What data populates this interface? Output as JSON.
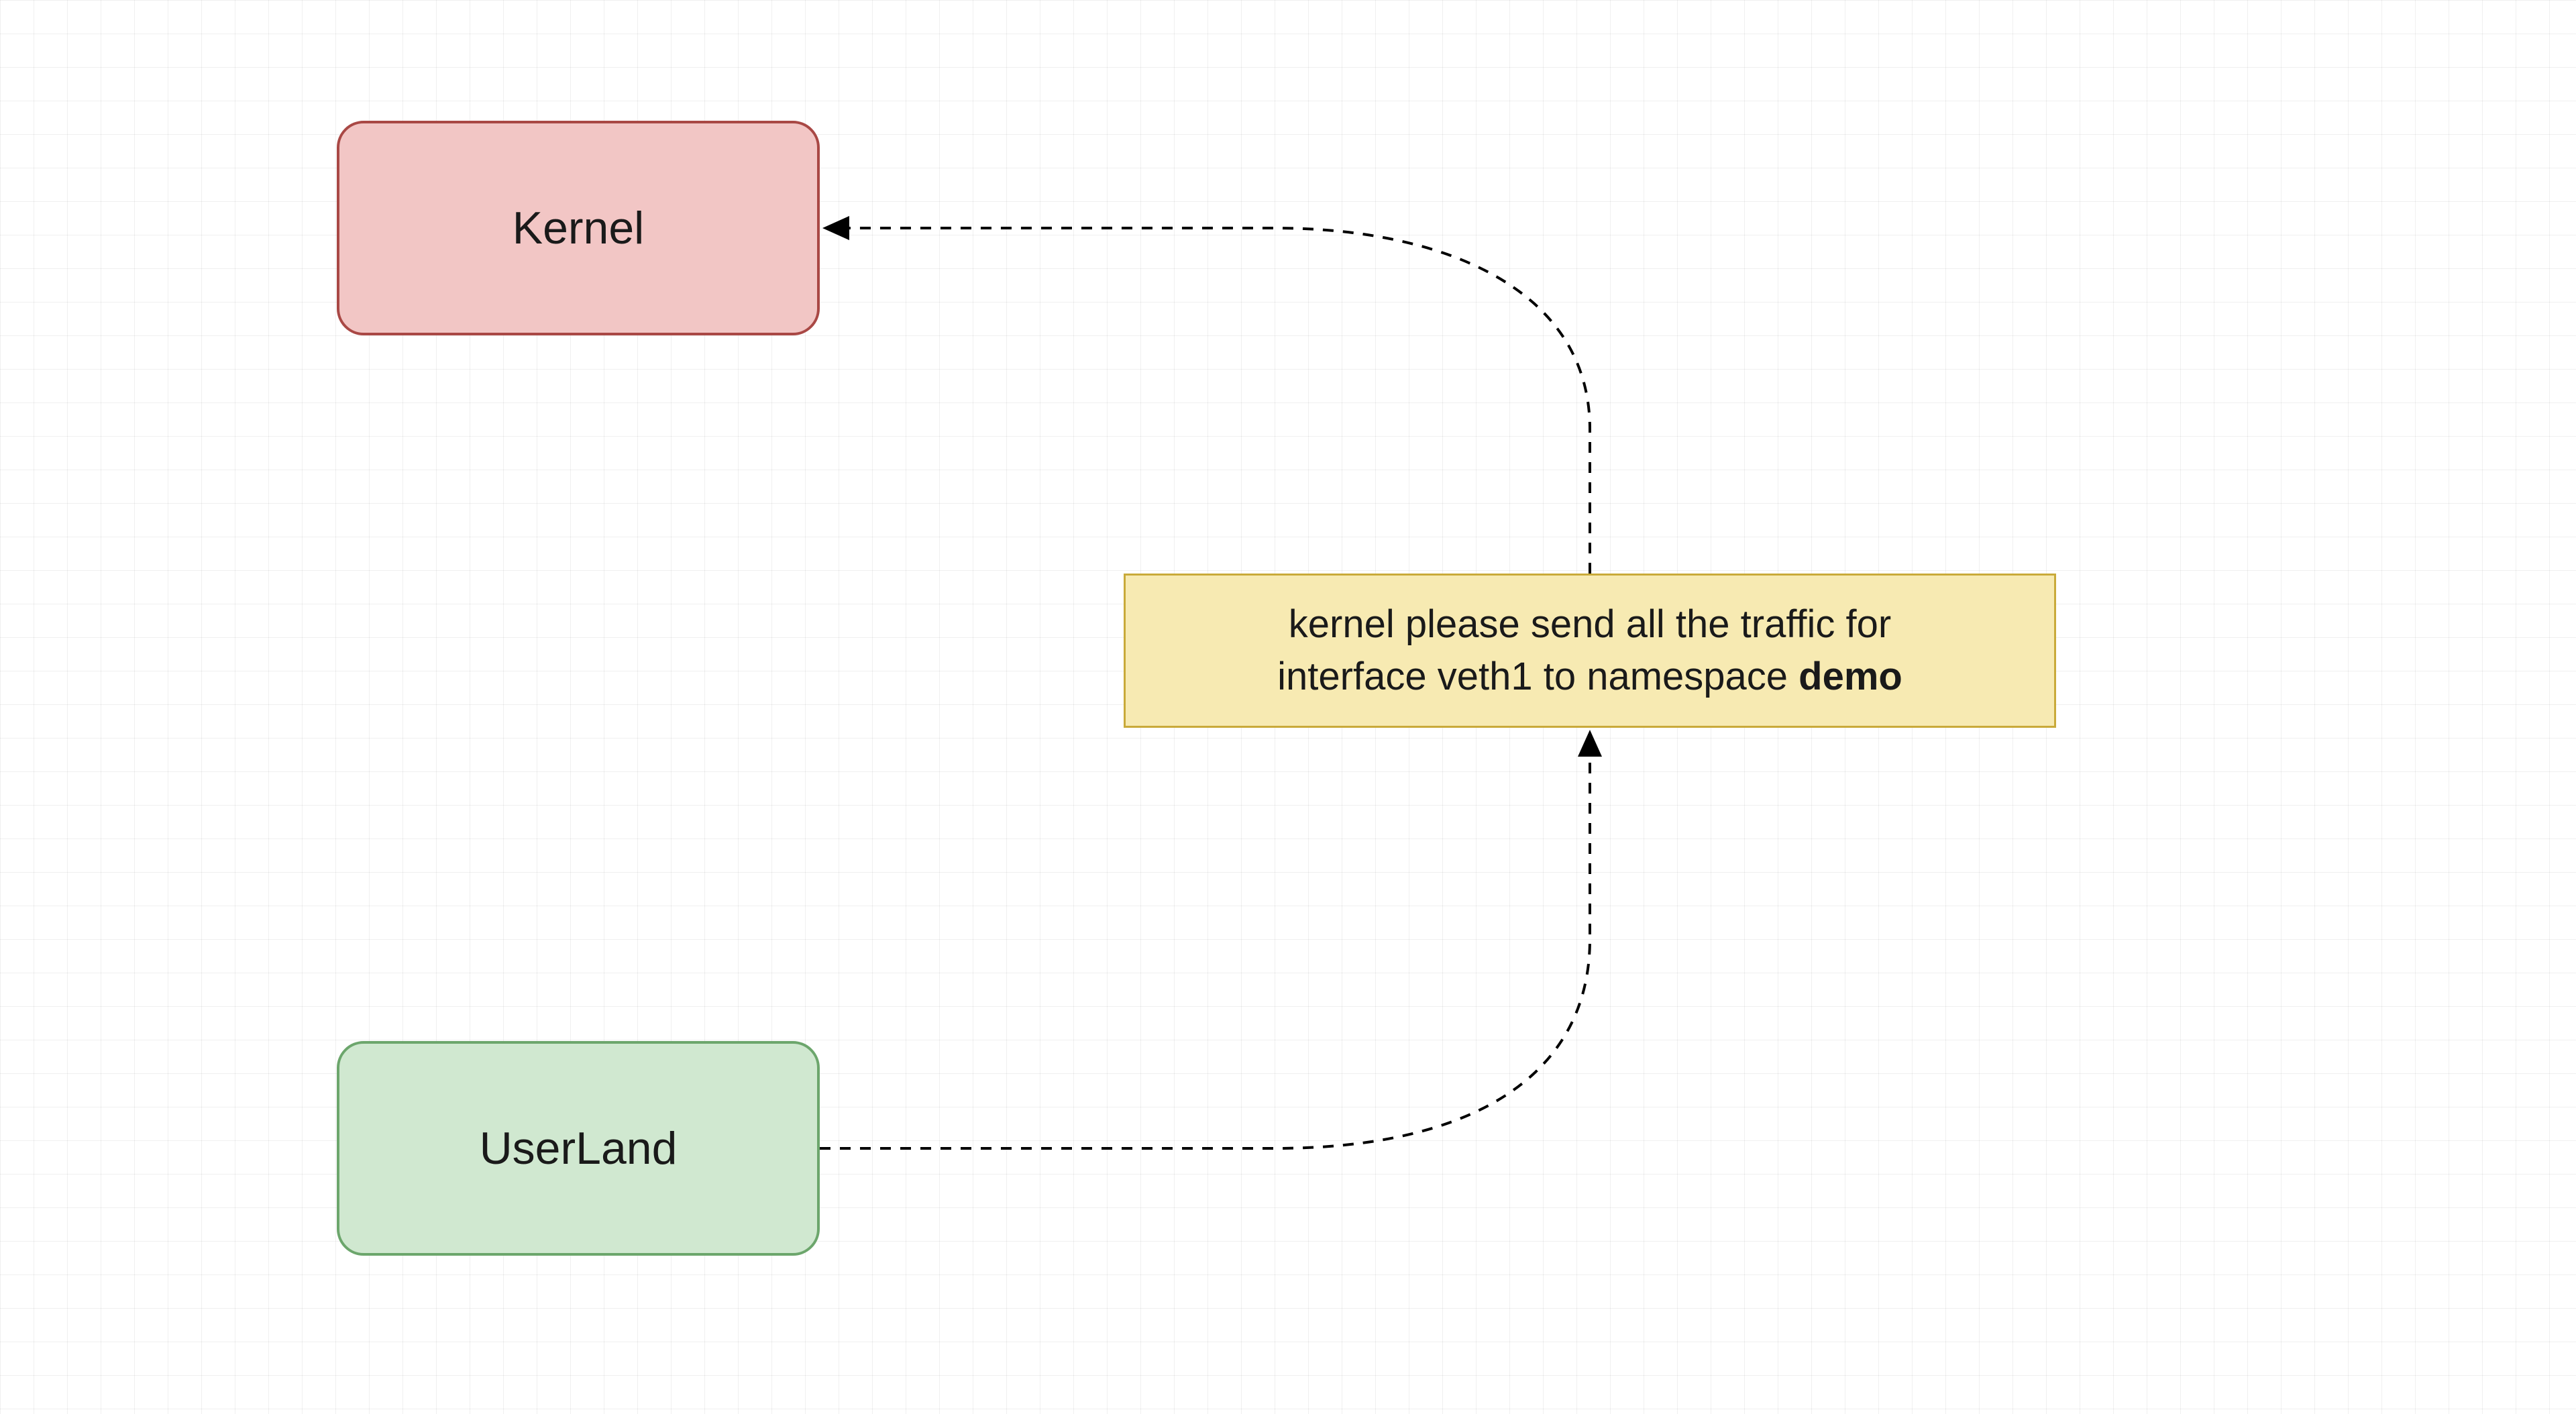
{
  "nodes": {
    "kernel": {
      "label": "Kernel"
    },
    "userland": {
      "label": "UserLand"
    }
  },
  "note": {
    "line1": "kernel please send all the traffic for",
    "line2_prefix": "interface veth1 to namespace ",
    "line2_bold": "demo"
  }
}
